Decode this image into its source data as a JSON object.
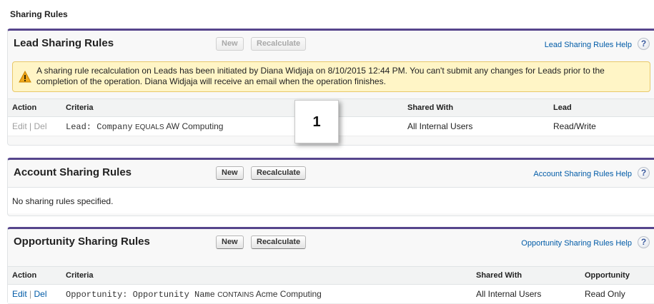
{
  "page": {
    "title": "Sharing Rules"
  },
  "lead": {
    "title": "Lead Sharing Rules",
    "new_label": "New",
    "recalculate_label": "Recalculate",
    "help_label": "Lead Sharing Rules Help",
    "warning_text": "A sharing rule recalculation on Leads has been initiated by Diana Widjaja on 8/10/2015 12:44 PM. You can't submit any changes for Leads prior to the completion of the operation. Diana Widjaja will receive an email when the operation finishes.",
    "columns": [
      "Action",
      "Criteria",
      "Shared With",
      "Lead"
    ],
    "row": {
      "edit": "Edit",
      "sep": "|",
      "del": "Del",
      "criteria_field": "Lead: Company",
      "criteria_op": "EQUALS",
      "criteria_value": "AW Computing",
      "shared_with": "All Internal Users",
      "access": "Read/Write"
    }
  },
  "account": {
    "title": "Account Sharing Rules",
    "new_label": "New",
    "recalculate_label": "Recalculate",
    "help_label": "Account Sharing Rules Help",
    "empty_text": "No sharing rules specified."
  },
  "opportunity": {
    "title": "Opportunity Sharing Rules",
    "new_label": "New",
    "recalculate_label": "Recalculate",
    "help_label": "Opportunity Sharing Rules Help",
    "columns": [
      "Action",
      "Criteria",
      "Shared With",
      "Opportunity"
    ],
    "row": {
      "edit": "Edit",
      "sep": "|",
      "del": "Del",
      "criteria_field": "Opportunity: Opportunity Name",
      "criteria_op": "CONTAINS",
      "criteria_value": "Acme Computing",
      "shared_with": "All Internal Users",
      "access": "Read Only"
    }
  },
  "help_icon_glyph": "?",
  "callout": {
    "number": "1"
  },
  "colors": {
    "section_border": "#56458c",
    "link": "#015ba7",
    "warning_bg": "#fff5c6"
  }
}
